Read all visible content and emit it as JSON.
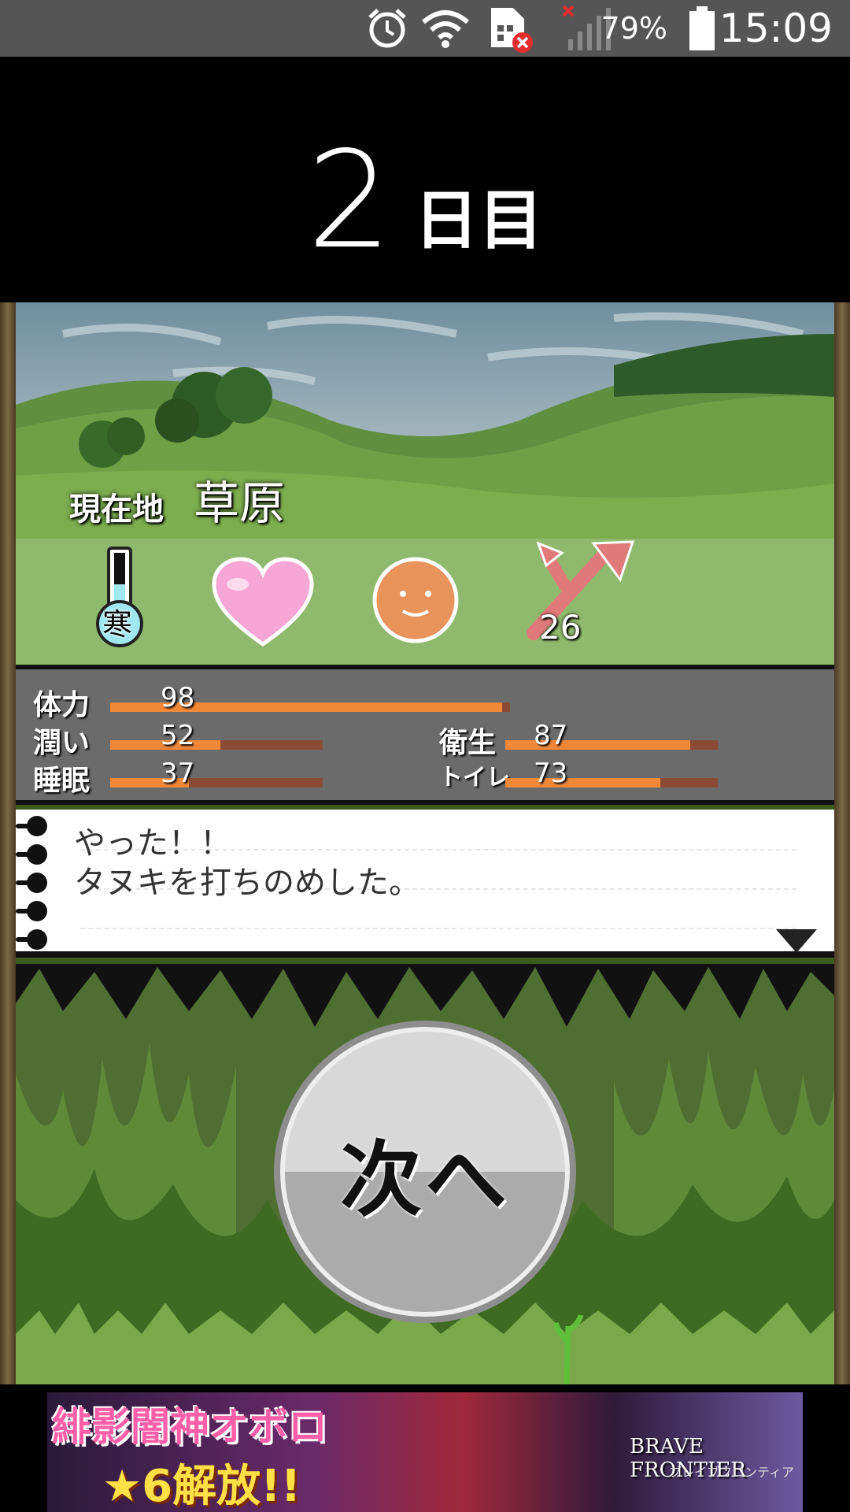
{
  "status_bar": {
    "battery_percent": "79%",
    "time": "15:09",
    "icons": [
      "alarm-icon",
      "wifi-icon",
      "sim-error-icon",
      "signal-icon",
      "battery-icon"
    ]
  },
  "header": {
    "day_number": "2",
    "day_unit": "日目"
  },
  "scene": {
    "location_label": "現在地",
    "location_name": "草原"
  },
  "status_icons": {
    "temperature_label": "寒",
    "weapon_count": "26",
    "icons": [
      "thermometer-icon",
      "heart-icon",
      "smiley-face-icon",
      "spear-icon"
    ]
  },
  "stats": [
    {
      "label": "体力",
      "value": 98,
      "max": 100
    },
    {
      "label": "潤い",
      "value": 52,
      "max": 100
    },
    {
      "label": "睡眠",
      "value": 37,
      "max": 100
    },
    {
      "label": "衛生",
      "value": 87,
      "max": 100
    },
    {
      "label": "トイレ",
      "value": 73,
      "max": 100
    }
  ],
  "message": {
    "lines": [
      "やった！！",
      "タヌキを打ちのめした。"
    ]
  },
  "next_button": {
    "label": "次へ"
  },
  "ad": {
    "title": "緋影闇神オボロ",
    "subtitle": "★6解放!!",
    "brand": "BRAVE FRONTIER",
    "brand_sub": "ブレイブフロンティア"
  },
  "colors": {
    "stat_fill": "#f08838",
    "stat_track": "#8b4a33",
    "heart": "#f7a6d6",
    "face": "#e8935a",
    "ad_title": "#ff5fa8",
    "ad_subtitle": "#ffe046"
  }
}
